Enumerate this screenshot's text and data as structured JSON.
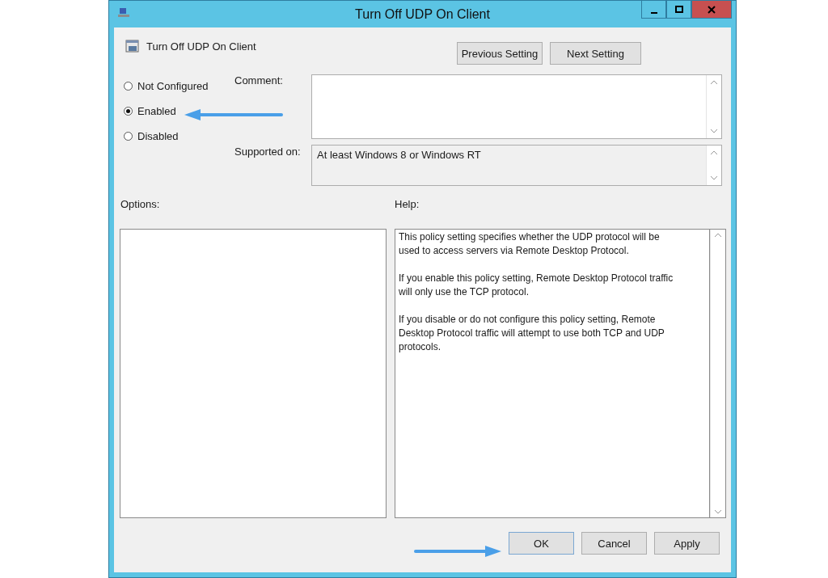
{
  "window": {
    "title": "Turn Off UDP On Client"
  },
  "header": {
    "title": "Turn Off UDP On Client"
  },
  "nav_buttons": [
    "Previous Setting",
    "Next Setting"
  ],
  "state_options": [
    {
      "label": "Not Configured",
      "selected": false
    },
    {
      "label": "Enabled",
      "selected": true
    },
    {
      "label": "Disabled",
      "selected": false
    }
  ],
  "comment": {
    "label": "Comment:"
  },
  "supported_on": {
    "label": "Supported on:",
    "value": "At least Windows 8 or Windows RT"
  },
  "options": {
    "label": "Options:"
  },
  "help": {
    "label": "Help:",
    "paragraphs": [
      "This policy setting specifies whether the UDP protocol will be used to access servers via Remote Desktop Protocol.",
      "If you enable this policy setting, Remote Desktop Protocol traffic will only use the TCP protocol.",
      "If you disable or do not configure this policy setting, Remote Desktop Protocol traffic will attempt to use both TCP and UDP protocols."
    ]
  },
  "buttons": [
    "OK",
    "Cancel",
    "Apply"
  ]
}
